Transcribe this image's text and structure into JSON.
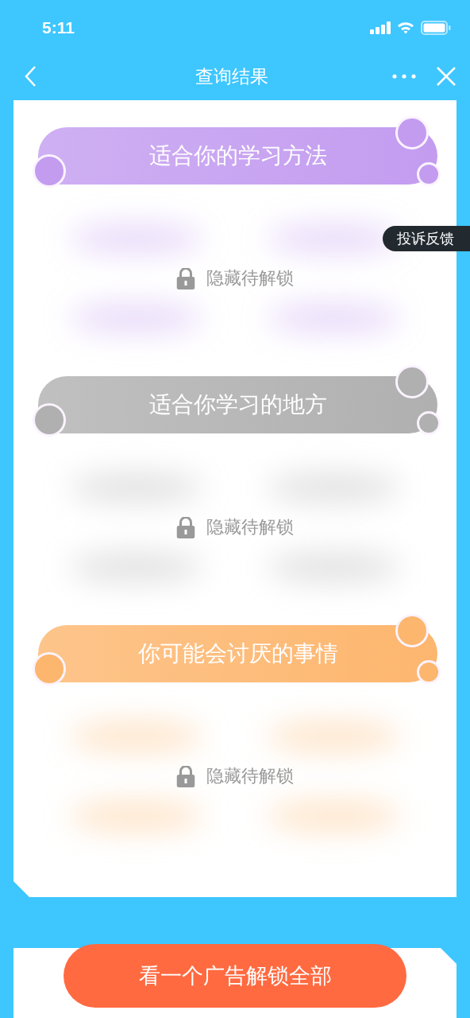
{
  "status_bar": {
    "time": "5:11"
  },
  "nav_bar": {
    "title": "查询结果"
  },
  "sections": [
    {
      "title": "适合你的学习方法",
      "color": "#c39cf0",
      "locked_label": "隐藏待解锁"
    },
    {
      "title": "适合你学习的地方",
      "color": "#b0b0b0",
      "locked_label": "隐藏待解锁"
    },
    {
      "title": "你可能会讨厌的事情",
      "color": "#fdb66e",
      "locked_label": "隐藏待解锁"
    }
  ],
  "feedback_tab": {
    "label": "投诉反馈"
  },
  "unlock_button": {
    "label": "看一个广告解锁全部"
  }
}
